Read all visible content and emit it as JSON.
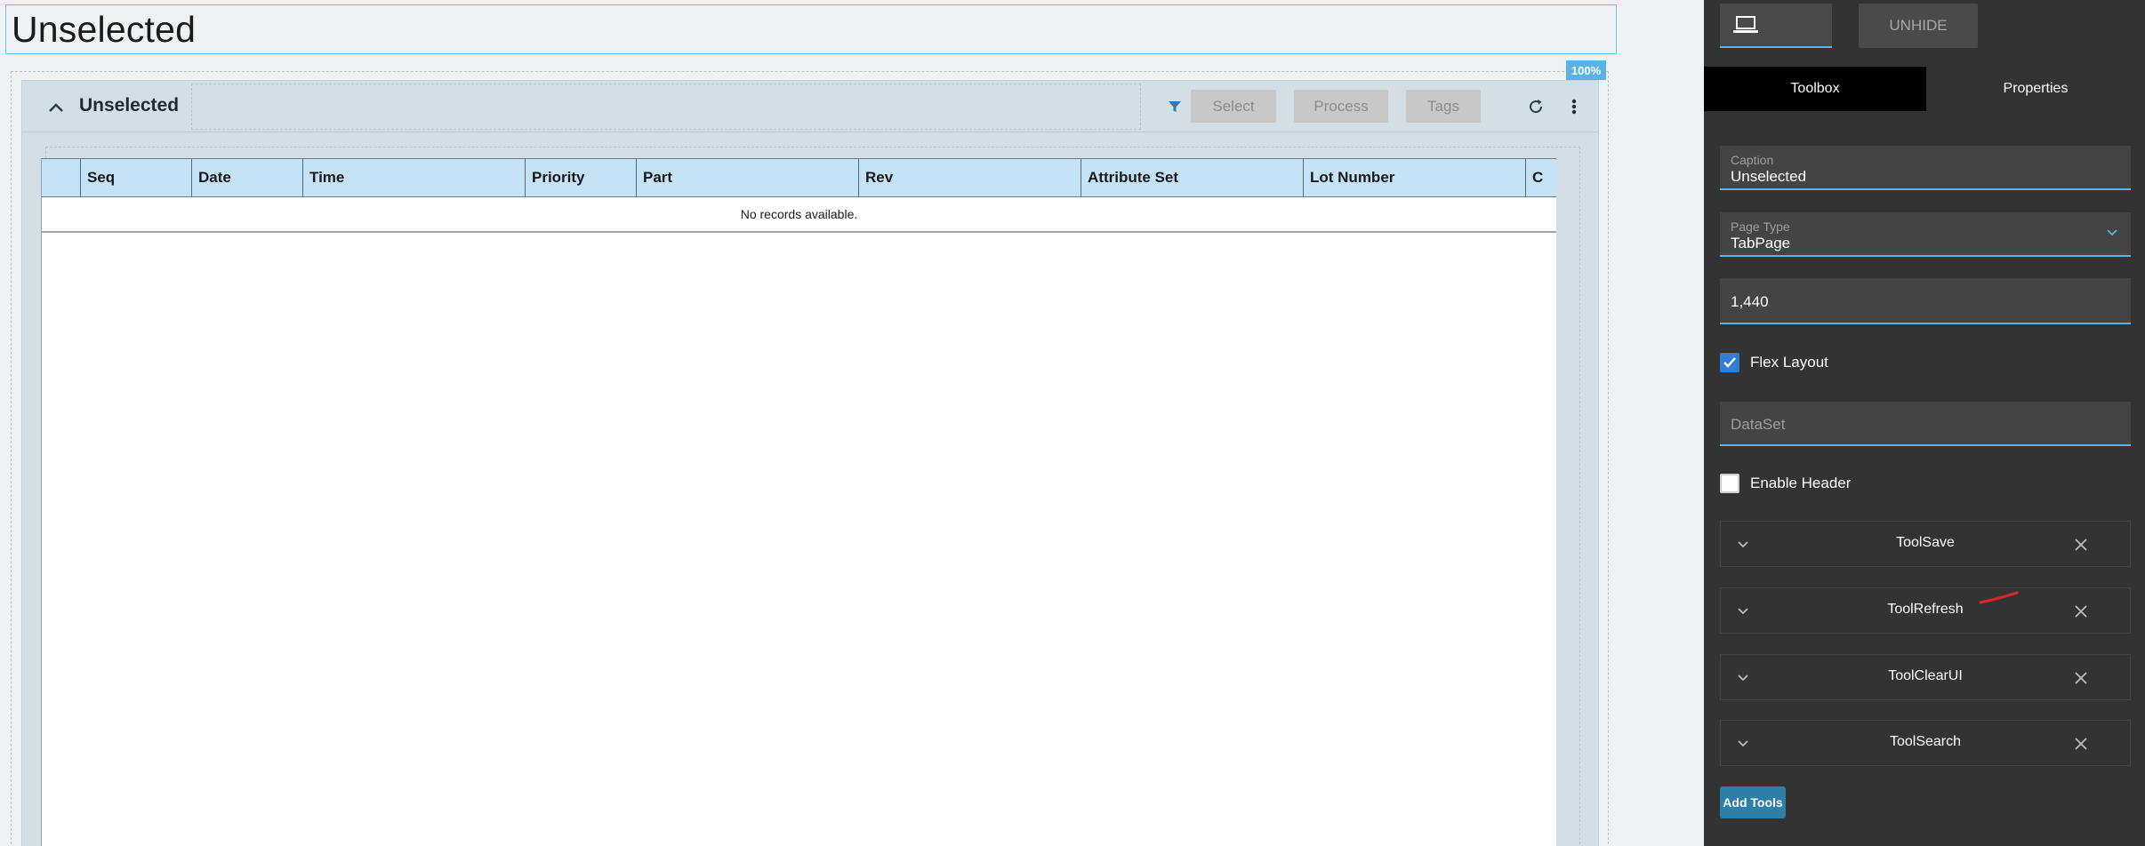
{
  "page": {
    "title": "Unselected",
    "zoom": "100%"
  },
  "panel": {
    "caption": "Unselected",
    "toolbar": {
      "select_label": "Select",
      "process_label": "Process",
      "tags_label": "Tags"
    }
  },
  "grid": {
    "columns": [
      "",
      "Seq",
      "Date",
      "Time",
      "Priority",
      "Part",
      "Rev",
      "Attribute Set",
      "Lot Number",
      "C"
    ],
    "empty_message": "No records available."
  },
  "sidebar": {
    "unhide_label": "UNHIDE",
    "tabs": [
      {
        "label": "Toolbox",
        "active": true
      },
      {
        "label": "Properties",
        "active": false
      }
    ],
    "caption_field": {
      "label": "Caption",
      "value": "Unselected"
    },
    "page_type_field": {
      "label": "Page Type",
      "value": "TabPage"
    },
    "width_field": {
      "value": "1,440"
    },
    "flex_layout": {
      "label": "Flex Layout",
      "checked": true
    },
    "dataset_field": {
      "placeholder": "DataSet"
    },
    "enable_header": {
      "label": "Enable Header",
      "checked": false
    },
    "tools": [
      "ToolSave",
      "ToolRefresh",
      "ToolClearUI",
      "ToolSearch"
    ],
    "add_tools_label": "Add Tools"
  },
  "colors": {
    "accent": "#58b4e4",
    "grid_header": "#c5e3f6",
    "sidebar_bg": "#333333",
    "add_tools_bg": "#2d7fa8",
    "annotation_red": "#d9262b"
  },
  "icons": {
    "device": "laptop-icon",
    "collapse": "chevron-up-icon",
    "filter": "filter-icon",
    "refresh": "refresh-icon",
    "more": "more-vertical-icon",
    "dropdown": "chevron-down-icon",
    "tool_expand": "chevron-down-icon",
    "tool_remove": "close-icon",
    "check": "check-icon"
  }
}
